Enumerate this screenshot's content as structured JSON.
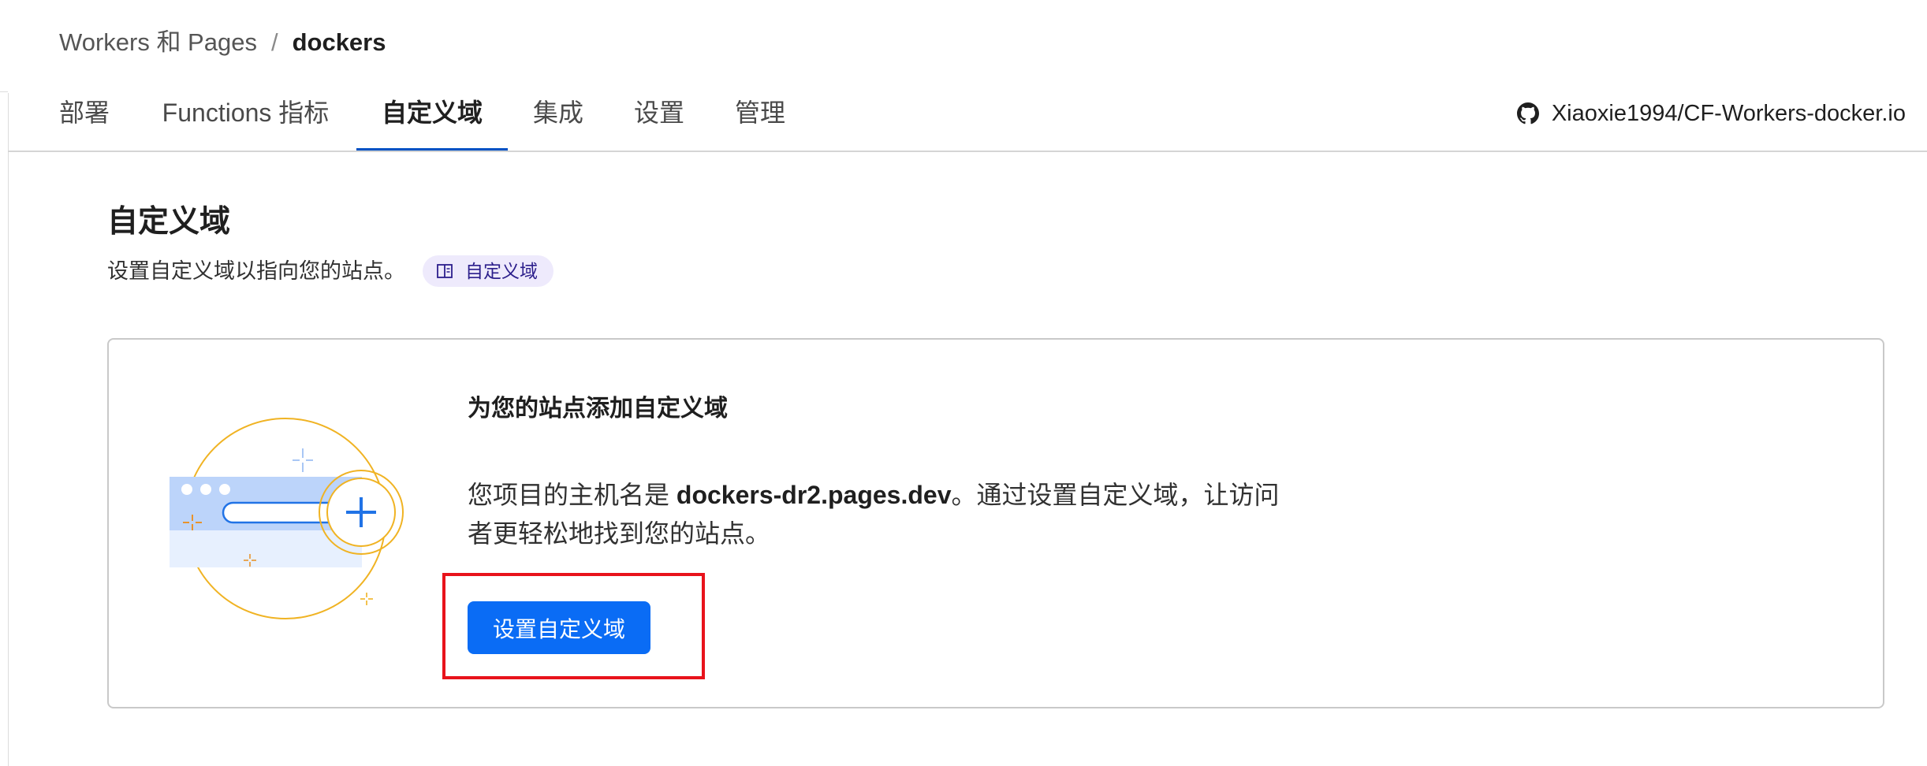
{
  "breadcrumb": {
    "parent": "Workers 和 Pages",
    "separator": "/",
    "current": "dockers"
  },
  "tabs": [
    {
      "label": "部署",
      "active": false
    },
    {
      "label": "Functions 指标",
      "active": false
    },
    {
      "label": "自定义域",
      "active": true
    },
    {
      "label": "集成",
      "active": false
    },
    {
      "label": "设置",
      "active": false
    },
    {
      "label": "管理",
      "active": false
    }
  ],
  "repo": {
    "icon": "github-icon",
    "label": "Xiaoxie1994/CF-Workers-docker.io"
  },
  "section": {
    "title": "自定义域",
    "description": "设置自定义域以指向您的站点。",
    "doc_link": {
      "icon": "book-icon",
      "label": "自定义域"
    }
  },
  "card": {
    "illustration": "add-domain-illustration",
    "title": "为您的站点添加自定义域",
    "body_prefix": "您项目的主机名是 ",
    "hostname": "dockers-dr2.pages.dev",
    "body_suffix": "。通过设置自定义域，让访问者更轻松地找到您的站点。",
    "button_label": "设置自定义域"
  },
  "colors": {
    "accent": "#0051c3",
    "primary_button": "#0a6cf5",
    "doc_pill_bg": "#eeeafc",
    "highlight": "#e8131b",
    "illustration_ring": "#f0b323",
    "illustration_blue": "#2173e6"
  }
}
